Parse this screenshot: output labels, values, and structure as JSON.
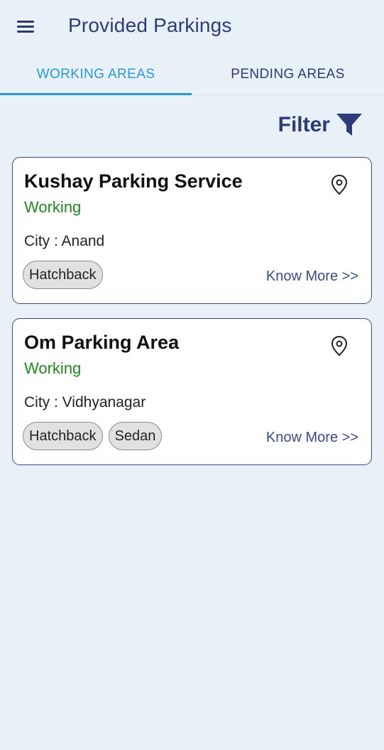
{
  "appbar": {
    "title": "Provided Parkings",
    "menu_icon": "menu-icon"
  },
  "tabs": [
    {
      "label": "WORKING AREAS",
      "active": true
    },
    {
      "label": "PENDING AREAS",
      "active": false
    }
  ],
  "filter": {
    "label": "Filter",
    "icon": "filter-icon"
  },
  "colors": {
    "primary": "#2f3b78",
    "active_tab": "#2a98d8",
    "status_working": "#1e8a1e",
    "background": "#e8f1f8"
  },
  "cards": [
    {
      "name": "Kushay Parking Service",
      "status": "Working",
      "city": "City : Anand",
      "vehicle_types": [
        "Hatchback"
      ],
      "link": "Know More >>"
    },
    {
      "name": "Om Parking Area",
      "status": "Working",
      "city": "City : Vidhyanagar",
      "vehicle_types": [
        "Hatchback",
        "Sedan"
      ],
      "link": "Know More >>"
    }
  ]
}
